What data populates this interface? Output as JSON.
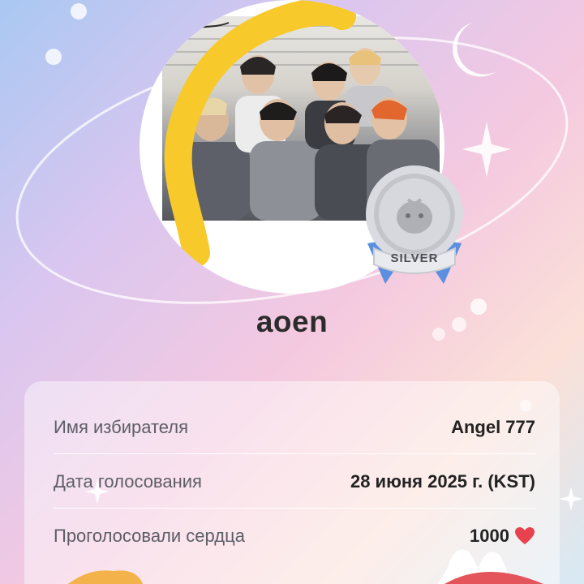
{
  "profile": {
    "username": "aoen",
    "badge_label": "SILVER"
  },
  "details": {
    "voter_name_label": "Имя избирателя",
    "voter_name_value": "Angel 777",
    "vote_date_label": "Дата голосования",
    "vote_date_value": "28 июня 2025 г. (KST)",
    "hearts_label": "Проголосовали сердца",
    "hearts_value": "1000"
  },
  "icons": {
    "heart": "heart-icon",
    "moon": "crescent-moon-icon",
    "sparkle": "sparkle-icon",
    "badge": "silver-medal-icon"
  },
  "colors": {
    "heart": "#e8424f",
    "medal_ribbon": "#5b8fe0",
    "medal_silver": "#c9cbd0",
    "yellow_stroke": "#f7c92a"
  }
}
